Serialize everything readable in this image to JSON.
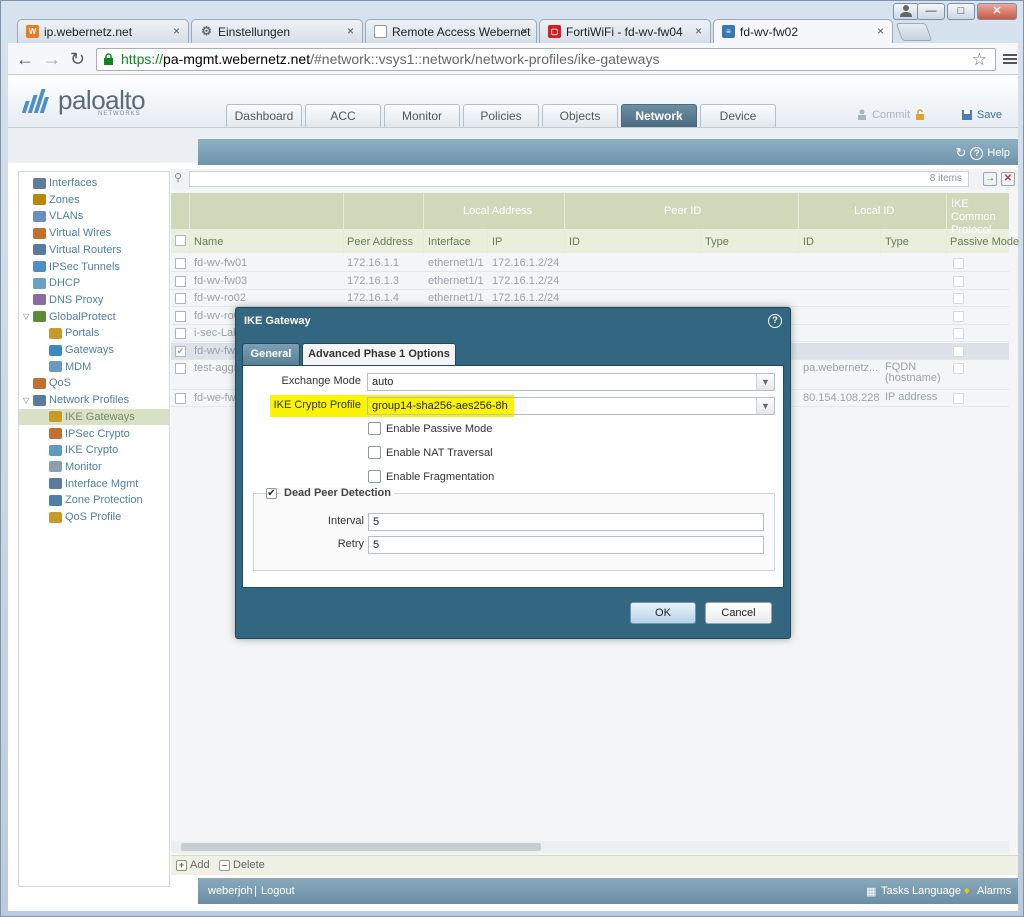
{
  "browser": {
    "tabs": [
      {
        "title": "ip.webernetz.net",
        "icon": "webernetz-favicon",
        "color": "#e87d1e"
      },
      {
        "title": "Einstellungen",
        "icon": "gear-icon",
        "color": "#777777"
      },
      {
        "title": "Remote Access Webernet",
        "icon": "page-icon",
        "color": "#999999"
      },
      {
        "title": "FortiWiFi - fd-wv-fw04",
        "icon": "fortinet-favicon",
        "color": "#d02020"
      },
      {
        "title": "fd-wv-fw02",
        "icon": "paloalto-favicon",
        "color": "#3a78b5"
      }
    ],
    "close_glyph": "×",
    "url": {
      "scheme": "https://",
      "host": "pa-mgmt.webernetz.net",
      "path": "/#network::vsys1::network/network-profiles/ike-gateways"
    }
  },
  "app": {
    "logo_text": "paloalto",
    "logo_sub": "NETWORKS",
    "tabs": [
      "Dashboard",
      "ACC",
      "Monitor",
      "Policies",
      "Objects",
      "Network",
      "Device"
    ],
    "active_tab": "Network",
    "commit_label": "Commit",
    "save_label": "Save",
    "help_label": "Help"
  },
  "sidebar": {
    "items": [
      {
        "label": "Interfaces",
        "indent": 0
      },
      {
        "label": "Zones",
        "indent": 0
      },
      {
        "label": "VLANs",
        "indent": 0
      },
      {
        "label": "Virtual Wires",
        "indent": 0
      },
      {
        "label": "Virtual Routers",
        "indent": 0
      },
      {
        "label": "IPSec Tunnels",
        "indent": 0
      },
      {
        "label": "DHCP",
        "indent": 0
      },
      {
        "label": "DNS Proxy",
        "indent": 0
      },
      {
        "label": "GlobalProtect",
        "indent": 0
      },
      {
        "label": "Portals",
        "indent": 1
      },
      {
        "label": "Gateways",
        "indent": 1
      },
      {
        "label": "MDM",
        "indent": 1
      },
      {
        "label": "QoS",
        "indent": 0
      },
      {
        "label": "Network Profiles",
        "indent": 0
      },
      {
        "label": "IKE Gateways",
        "indent": 1
      },
      {
        "label": "IPSec Crypto",
        "indent": 1
      },
      {
        "label": "IKE Crypto",
        "indent": 1
      },
      {
        "label": "Monitor",
        "indent": 1
      },
      {
        "label": "Interface Mgmt",
        "indent": 1
      },
      {
        "label": "Zone Protection",
        "indent": 1
      },
      {
        "label": "QoS Profile",
        "indent": 1
      }
    ],
    "active": "IKE Gateways"
  },
  "grid": {
    "item_count": "8 items",
    "group_headers": {
      "local_address": "Local Address",
      "peer_id": "Peer ID",
      "local_id": "Local ID",
      "ike_common": "IKE Common Protocol"
    },
    "columns": {
      "name": "Name",
      "peer_address": "Peer Address",
      "interface": "Interface",
      "ip": "IP",
      "peer_id": "ID",
      "peer_type": "Type",
      "local_id": "ID",
      "local_type": "Type",
      "passive": "Passive Mode"
    },
    "rows": [
      {
        "name": "fd-wv-fw01",
        "peer": "172.16.1.1",
        "iface": "ethernet1/1",
        "ip": "172.16.1.2/24",
        "lid": "",
        "ltype": ""
      },
      {
        "name": "fd-wv-fw03",
        "peer": "172.16.1.3",
        "iface": "ethernet1/1",
        "ip": "172.16.1.2/24",
        "lid": "",
        "ltype": ""
      },
      {
        "name": "fd-wv-ro02",
        "peer": "172.16.1.4",
        "iface": "ethernet1/1",
        "ip": "172.16.1.2/24",
        "lid": "",
        "ltype": ""
      },
      {
        "name": "fd-wv-ro0",
        "peer": "",
        "iface": "",
        "ip": "",
        "lid": "",
        "ltype": ""
      },
      {
        "name": "i-sec-Lab",
        "peer": "",
        "iface": "",
        "ip": "",
        "lid": "",
        "ltype": ""
      },
      {
        "name": "fd-wv-fw",
        "peer": "",
        "iface": "",
        "ip": "",
        "lid": "",
        "ltype": ""
      },
      {
        "name": "test-aggr",
        "peer": "",
        "iface": "",
        "ip": "",
        "lid": "pa.webernetz...",
        "ltype": "FQDN (hostname)"
      },
      {
        "name": "fd-we-fw",
        "peer": "",
        "iface": "",
        "ip": "",
        "lid": "80.154.108.228",
        "ltype": "IP address"
      }
    ],
    "add_label": "Add",
    "delete_label": "Delete"
  },
  "footer": {
    "user": "weberjoh",
    "logout": "Logout",
    "tasks": "Tasks",
    "language": "Language",
    "alarms": "Alarms"
  },
  "dialog": {
    "title": "IKE Gateway",
    "tabs": {
      "general": "General",
      "advanced": "Advanced Phase 1 Options"
    },
    "exchange_mode_label": "Exchange Mode",
    "exchange_mode": "auto",
    "crypto_profile_label": "IKE Crypto Profile",
    "crypto_profile": "group14-sha256-aes256-8h",
    "passive_mode_label": "Enable Passive Mode",
    "nat_traversal_label": "Enable NAT Traversal",
    "fragmentation_label": "Enable Fragmentation",
    "dpd_label": "Dead Peer Detection",
    "interval_label": "Interval",
    "interval": "5",
    "retry_label": "Retry",
    "retry": "5",
    "ok_label": "OK",
    "cancel_label": "Cancel",
    "checked_glyph": "✔",
    "highlight_color": "#fbf400"
  }
}
